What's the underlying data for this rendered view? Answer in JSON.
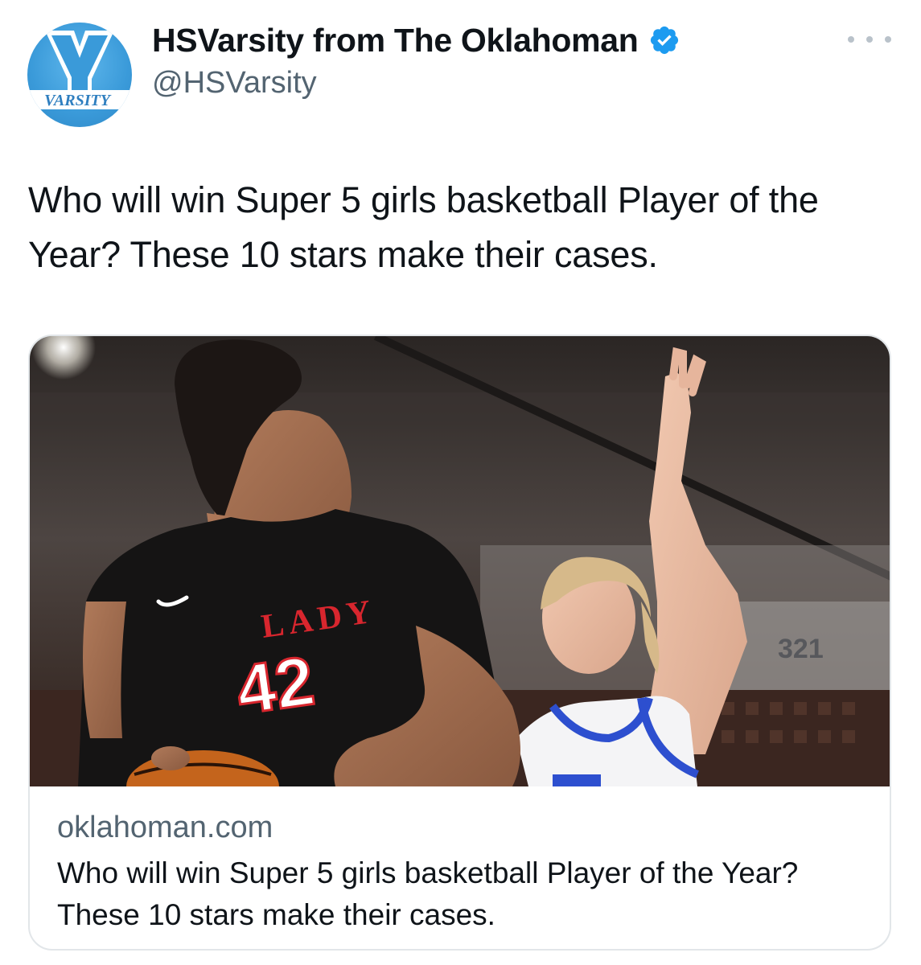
{
  "author": {
    "display_name": "HSVarsity from The Oklahoman",
    "handle": "@HSVarsity",
    "verified": true,
    "avatar_letter": "V",
    "avatar_text": "VARSITY"
  },
  "tweet": {
    "text": "Who will win Super 5 girls basketball Player of the Year? These 10 stars make their cases."
  },
  "link_card": {
    "domain": "oklahoman.com",
    "title": "Who will win Super 5 girls basketball Player of the Year? These 10 stars make their cases.",
    "image": {
      "jersey_text": "LADY",
      "jersey_number": "42",
      "background_number": "321"
    }
  },
  "colors": {
    "verified_blue": "#1d9bf0",
    "avatar_blue": "#3a9ad9",
    "secondary_text": "#536471",
    "jersey_red": "#d8262e"
  },
  "icons": {
    "verified": "verified-badge-icon",
    "more": "more-options-icon"
  }
}
